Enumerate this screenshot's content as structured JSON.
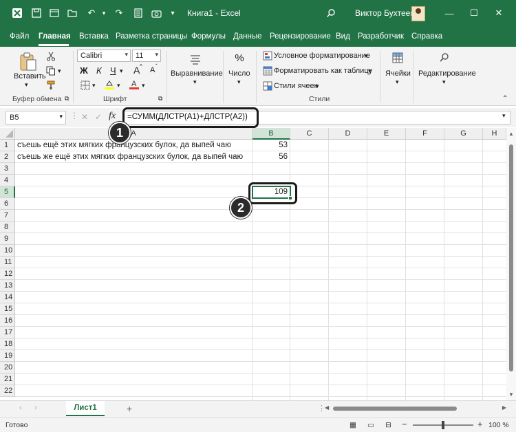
{
  "titlebar": {
    "app_title": "Книга1 - Excel",
    "user_name": "Виктор Бухтеев",
    "qa_icons": [
      "excel-logo-icon",
      "save-icon",
      "autosave-icon",
      "undo-icon",
      "redo-icon",
      "form-icon",
      "camera-icon"
    ]
  },
  "tabs": [
    "Файл",
    "Главная",
    "Вставка",
    "Разметка страницы",
    "Формулы",
    "Данные",
    "Рецензирование",
    "Вид",
    "Разработчик",
    "Справка"
  ],
  "ribbon": {
    "clipboard": {
      "paste": "Вставить",
      "label": "Буфер обмена"
    },
    "font": {
      "name": "Calibri",
      "size": "11",
      "bold": "Ж",
      "italic": "К",
      "underline": "Ч",
      "grow": "A",
      "shrink": "A",
      "highlight_color": "#ffff00",
      "font_color": "#e23b2a",
      "label": "Шрифт"
    },
    "alignment": {
      "label": "Выравнивание"
    },
    "number": {
      "label": "Число"
    },
    "styles": {
      "conditional": "Условное форматирование",
      "as_table": "Форматировать как таблицу",
      "cell_styles": "Стили ячеек",
      "label": "Стили"
    },
    "cells": {
      "label": "Ячейки"
    },
    "editing": {
      "label": "Редактирование"
    }
  },
  "formula_bar": {
    "name_box": "B5",
    "formula": "=СУММ(ДЛСТР(A1)+ДЛСТР(A2))"
  },
  "callouts": [
    "1",
    "2"
  ],
  "grid": {
    "columns": [
      "A",
      "B",
      "C",
      "D",
      "E",
      "F",
      "G",
      "H"
    ],
    "rows": [
      "1",
      "2",
      "3",
      "4",
      "5",
      "6",
      "7",
      "8",
      "9",
      "10",
      "11",
      "12",
      "13",
      "14",
      "15",
      "16",
      "17",
      "18",
      "19",
      "20",
      "21",
      "22"
    ],
    "cells": {
      "A1": "съешь ещё этих мягких французских булок, да выпей чаю",
      "B1": "53",
      "A2": "съешь же ещё этих мягких французских булок, да выпей чаю",
      "B2": "56",
      "B5": "109"
    },
    "selected_cell": "B5"
  },
  "sheetbar": {
    "sheet_name": "Лист1",
    "add_label": "+"
  },
  "status": {
    "ready": "Готово",
    "zoom": "100 %",
    "zoom_minus": "−",
    "zoom_plus": "+"
  },
  "colors": {
    "accent": "#217346"
  }
}
